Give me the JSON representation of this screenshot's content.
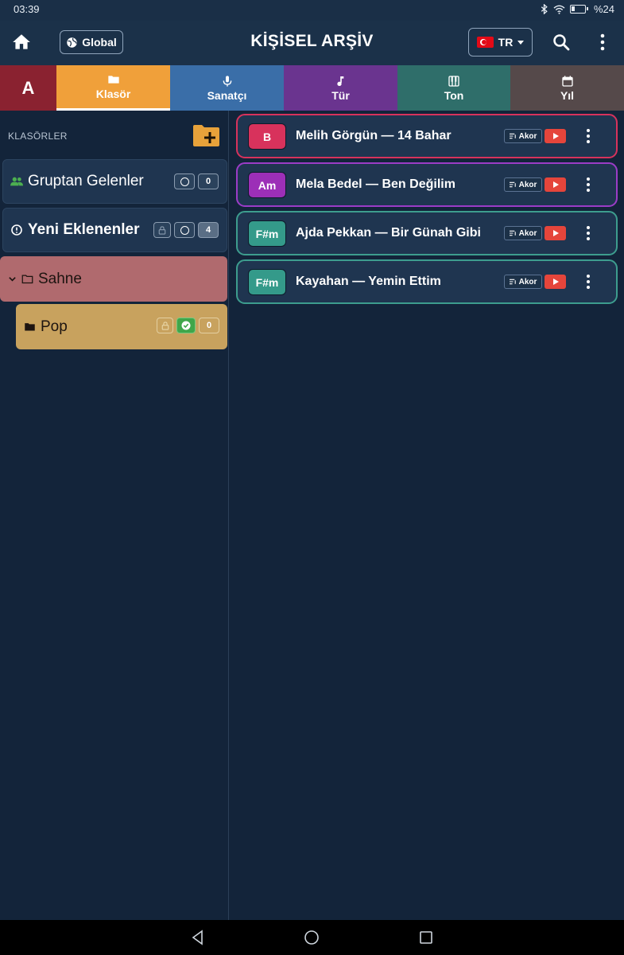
{
  "status": {
    "time": "03:39",
    "battery": "%24"
  },
  "header": {
    "title": "KİŞİSEL ARŞİV",
    "global_label": "Global",
    "lang_label": "TR"
  },
  "tabs": [
    {
      "label": "A"
    },
    {
      "label": "Klasör"
    },
    {
      "label": "Sanatçı"
    },
    {
      "label": "Tür"
    },
    {
      "label": "Ton"
    },
    {
      "label": "Yıl"
    }
  ],
  "folders": {
    "title": "KLASÖRLER",
    "items": [
      {
        "label": "Gruptan Gelenler",
        "count": "0"
      },
      {
        "label": "Yeni Eklenenler",
        "count": "4"
      },
      {
        "label": "Sahne"
      },
      {
        "label": "Pop",
        "count": "0"
      }
    ]
  },
  "songs": [
    {
      "key": "B",
      "title": "Melih Görgün — 14 Bahar",
      "akor": "Akor"
    },
    {
      "key": "Am",
      "title": "Mela Bedel — Ben Değilim",
      "akor": "Akor"
    },
    {
      "key": "F#m",
      "title": "Ajda Pekkan — Bir Günah Gibi",
      "akor": "Akor"
    },
    {
      "key": "F#m",
      "title": "Kayahan — Yemin Ettim",
      "akor": "Akor"
    }
  ],
  "colors": {
    "key_b": "#d8325c",
    "key_am": "#9c2fb7",
    "key_fsm": "#349a8a",
    "border_b": "#d8325c",
    "border_am": "#9b3cc7",
    "border_fsm": "#3d9d8e"
  }
}
